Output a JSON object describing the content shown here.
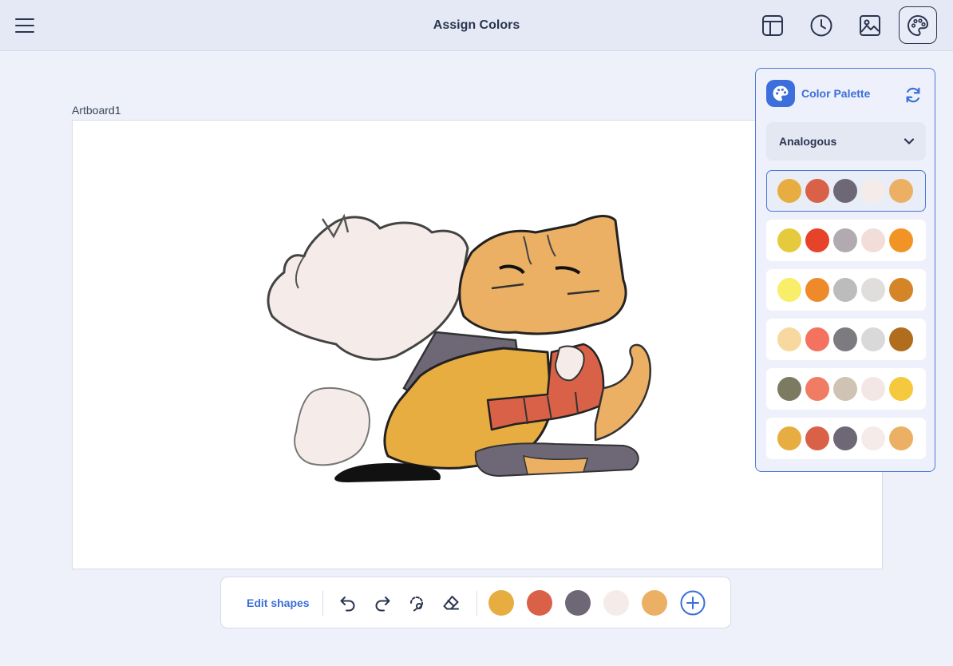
{
  "header": {
    "title": "Assign Colors"
  },
  "icons": {
    "menu": "hamburger-menu-icon",
    "layout": "layout-panel-icon",
    "history": "clock-history-icon",
    "image": "image-icon",
    "palette": "palette-icon"
  },
  "artboard": {
    "label": "Artboard1"
  },
  "palette_panel": {
    "title": "Color Palette",
    "harmony": "Analogous",
    "selected_index": 0,
    "palettes": [
      [
        "#e8ad40",
        "#d96147",
        "#6e6876",
        "#f5ecea",
        "#ebb064"
      ],
      [
        "#e6ca3e",
        "#e6432a",
        "#b1aab0",
        "#f2ddd9",
        "#f29425"
      ],
      [
        "#f8ee6a",
        "#ee8a2a",
        "#bcbcbc",
        "#e0dddd",
        "#d38527"
      ],
      [
        "#f7d9a0",
        "#f47260",
        "#7d7a80",
        "#d9d9d9",
        "#b06d1d"
      ],
      [
        "#7c7a60",
        "#f17c64",
        "#cfc3b3",
        "#f3e7e6",
        "#f5c93e"
      ],
      [
        "#e8ad40",
        "#d96147",
        "#6e6876",
        "#f5ecea",
        "#ebb064"
      ]
    ]
  },
  "bottom_toolbar": {
    "edit_shapes_label": "Edit shapes",
    "tools": [
      "undo-icon",
      "redo-icon",
      "lasso-icon",
      "eraser-icon"
    ],
    "swatches": [
      "#e8ad40",
      "#d96147",
      "#6e6876",
      "#f5ecea",
      "#ebb064"
    ],
    "add_icon": "plus-circle-icon"
  },
  "colors": {
    "accent": "#3b6fd9",
    "text_dark": "#2b3550",
    "background": "#eef1fa"
  }
}
